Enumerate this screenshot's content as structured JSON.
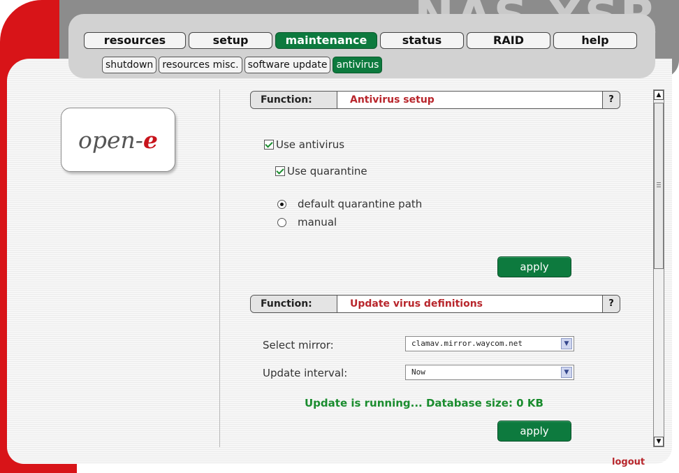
{
  "brand": "NAS-XSR",
  "tabs": [
    {
      "label": "resources"
    },
    {
      "label": "setup"
    },
    {
      "label": "maintenance"
    },
    {
      "label": "status"
    },
    {
      "label": "RAID"
    },
    {
      "label": "help"
    }
  ],
  "subtabs": [
    {
      "label": "shutdown"
    },
    {
      "label": "resources misc."
    },
    {
      "label": "software update"
    },
    {
      "label": "antivirus"
    }
  ],
  "logo": {
    "text_main": "open-",
    "text_accent": "e"
  },
  "antivirus_setup": {
    "function_label": "Function:",
    "title": "Antivirus setup",
    "help": "?",
    "use_antivirus": {
      "label": "Use antivirus",
      "checked": true
    },
    "use_quarantine": {
      "label": "Use quarantine",
      "checked": true
    },
    "radio_default": {
      "label": "default quarantine path",
      "selected": true
    },
    "radio_manual": {
      "label": "manual",
      "selected": false
    },
    "apply": "apply"
  },
  "update_definitions": {
    "function_label": "Function:",
    "title": "Update virus definitions",
    "help": "?",
    "mirror_label": "Select mirror:",
    "mirror_value": "clamav.mirror.waycom.net",
    "interval_label": "Update interval:",
    "interval_value": "Now",
    "status": "Update is running... Database size: 0 KB",
    "apply": "apply"
  },
  "logout": "logout",
  "colors": {
    "accent_green": "#0d7a3e",
    "title_red": "#b8262c",
    "status_green": "#1a8c2e",
    "frame_red": "#d81418"
  }
}
